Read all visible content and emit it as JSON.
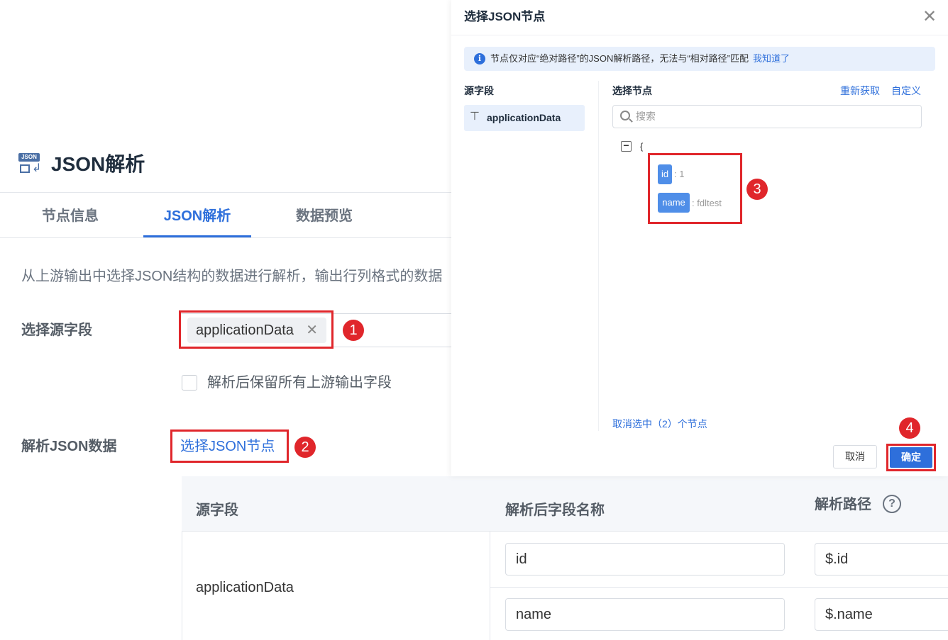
{
  "page": {
    "icon": "json-parse-icon",
    "icon_tag": "JSON",
    "title": "JSON解析",
    "tabs": [
      {
        "label": "节点信息",
        "active": false
      },
      {
        "label": "JSON解析",
        "active": true
      },
      {
        "label": "数据预览",
        "active": false
      }
    ],
    "description": "从上游输出中选择JSON结构的数据进行解析，输出行列格式的数据",
    "source_field": {
      "label": "选择源字段",
      "selected_tag": "applicationData"
    },
    "keep_fields_checkbox": {
      "label": "解析后保留所有上游输出字段",
      "checked": false
    },
    "parse_json": {
      "label": "解析JSON数据",
      "link": "选择JSON节点"
    },
    "table": {
      "headers": [
        "源字段",
        "解析后字段名称",
        "解析路径"
      ],
      "source": "applicationData",
      "rows": [
        {
          "name": "id",
          "path": "$.id"
        },
        {
          "name": "name",
          "path": "$.name"
        }
      ]
    }
  },
  "dialog": {
    "title": "选择JSON节点",
    "info": {
      "text": "节点仅对应“绝对路径”的JSON解析路径，无法与“相对路径”匹配",
      "link": "我知道了"
    },
    "left_label": "源字段",
    "source_item": "applicationData",
    "right_label": "选择节点",
    "refresh_link": "重新获取",
    "custom_link": "自定义",
    "search_placeholder": "搜索",
    "tree": {
      "collapse_symbol": "−",
      "open_brace": "{",
      "nodes": [
        {
          "key": "id",
          "value": ": 1"
        },
        {
          "key": "name",
          "value": ": fdltest"
        }
      ]
    },
    "deselect": "取消选中（2）个节点",
    "cancel": "取消",
    "confirm": "确定"
  },
  "annotations": [
    "1",
    "2",
    "3",
    "4"
  ],
  "colors": {
    "accent": "#2e6fdb",
    "highlight_red": "#e0262b",
    "info_bg": "#e8f0fc"
  }
}
